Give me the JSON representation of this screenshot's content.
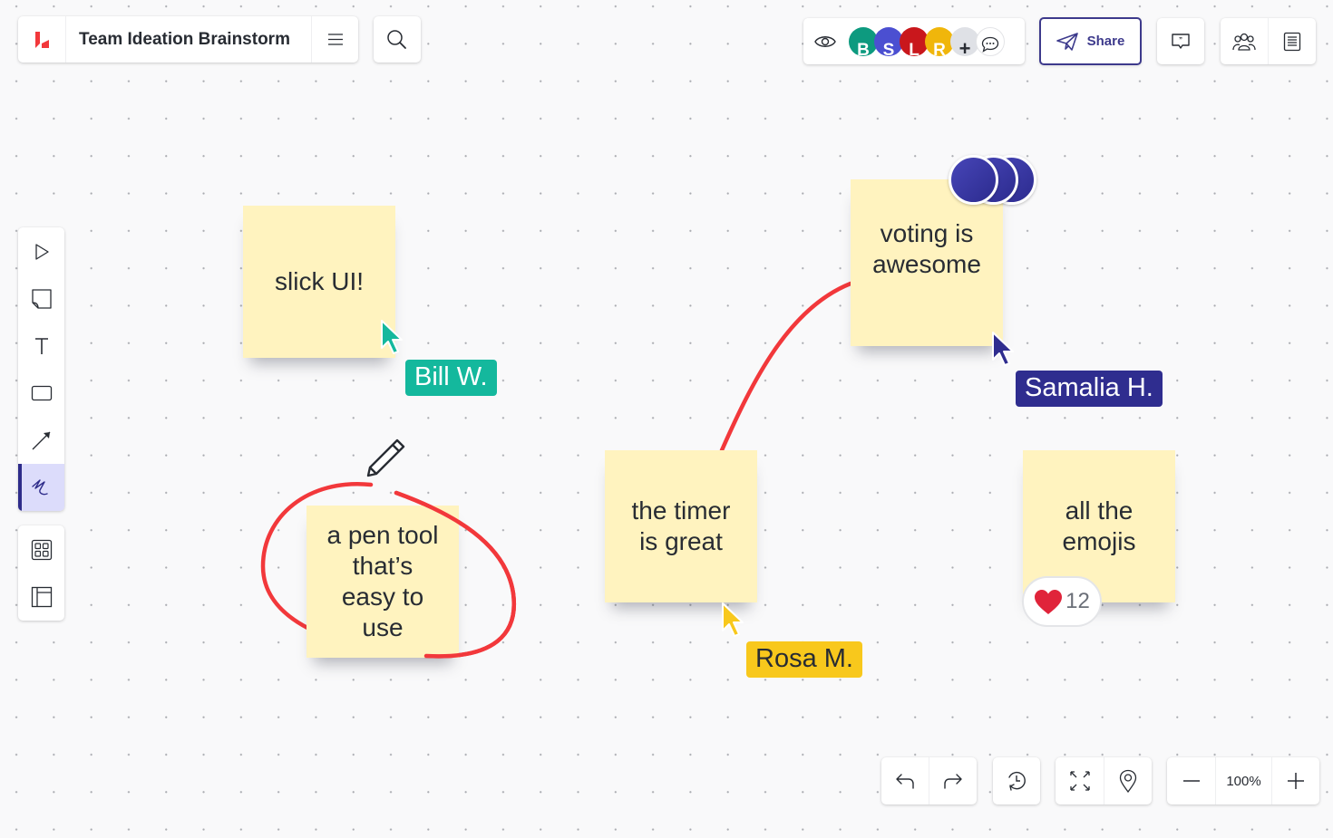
{
  "header": {
    "app_logo": "lucid-logo-icon",
    "document_title": "Team Ideation Brainstorm",
    "menu_icon": "hamburger-menu-icon",
    "search_icon": "search-icon"
  },
  "collaborators": {
    "view_icon": "eye-icon",
    "avatars": [
      {
        "initial": "B",
        "color": "#0d9a7f"
      },
      {
        "initial": "S",
        "color": "#4b4fd1"
      },
      {
        "initial": "L",
        "color": "#c9171c"
      },
      {
        "initial": "R",
        "color": "#f0b60b"
      }
    ],
    "more_label": "+",
    "chat_icon": "chat-bubble-icon"
  },
  "share": {
    "label": "Share",
    "icon": "paper-plane-icon",
    "color": "#3d3a8c"
  },
  "right_actions": {
    "comments_icon": "comment-quote-icon",
    "collaborators_icon": "people-icon",
    "notes_icon": "document-icon"
  },
  "toolbar": {
    "tools": [
      {
        "name": "select",
        "icon": "pointer-icon"
      },
      {
        "name": "sticky-note",
        "icon": "sticky-note-icon"
      },
      {
        "name": "text",
        "icon": "text-icon"
      },
      {
        "name": "shape",
        "icon": "rectangle-icon"
      },
      {
        "name": "line",
        "icon": "arrow-line-icon"
      },
      {
        "name": "pen",
        "icon": "pen-scribble-icon",
        "active": true
      }
    ],
    "secondary": [
      {
        "name": "templates",
        "icon": "grid-icon"
      },
      {
        "name": "layout",
        "icon": "layout-icon"
      }
    ],
    "active_color": "#2e2c8a"
  },
  "stickies": [
    {
      "id": "slick-ui",
      "text": "slick UI!"
    },
    {
      "id": "pen-tool",
      "text": "a pen tool\nthat’s\neasy to\nuse"
    },
    {
      "id": "timer",
      "text": "the timer\nis great"
    },
    {
      "id": "voting",
      "text": "voting is\nawesome"
    },
    {
      "id": "emojis",
      "text": "all the\nemojis"
    }
  ],
  "sticky_color": "#fff3bf",
  "cursors": [
    {
      "name": "Bill W.",
      "color": "#14b89d",
      "text_color": "#ffffff"
    },
    {
      "name": "Samalia H.",
      "color": "#2f2d8f",
      "text_color": "#ffffff"
    },
    {
      "name": "Rosa M.",
      "color": "#f8c81c",
      "text_color": "#282c33"
    }
  ],
  "votes": {
    "count": 3,
    "color": "#3b3aa6"
  },
  "reaction": {
    "emoji": "❤",
    "count": "12",
    "color": "#e0243a"
  },
  "ink_color": "#f2383b",
  "bottom_controls": {
    "undo_icon": "undo-icon",
    "redo_icon": "redo-icon",
    "history_icon": "history-icon",
    "fit_icon": "fit-to-screen-icon",
    "location_icon": "location-pin-icon",
    "zoom_out_icon": "minus-icon",
    "zoom_level": "100%",
    "zoom_in_icon": "plus-icon"
  }
}
